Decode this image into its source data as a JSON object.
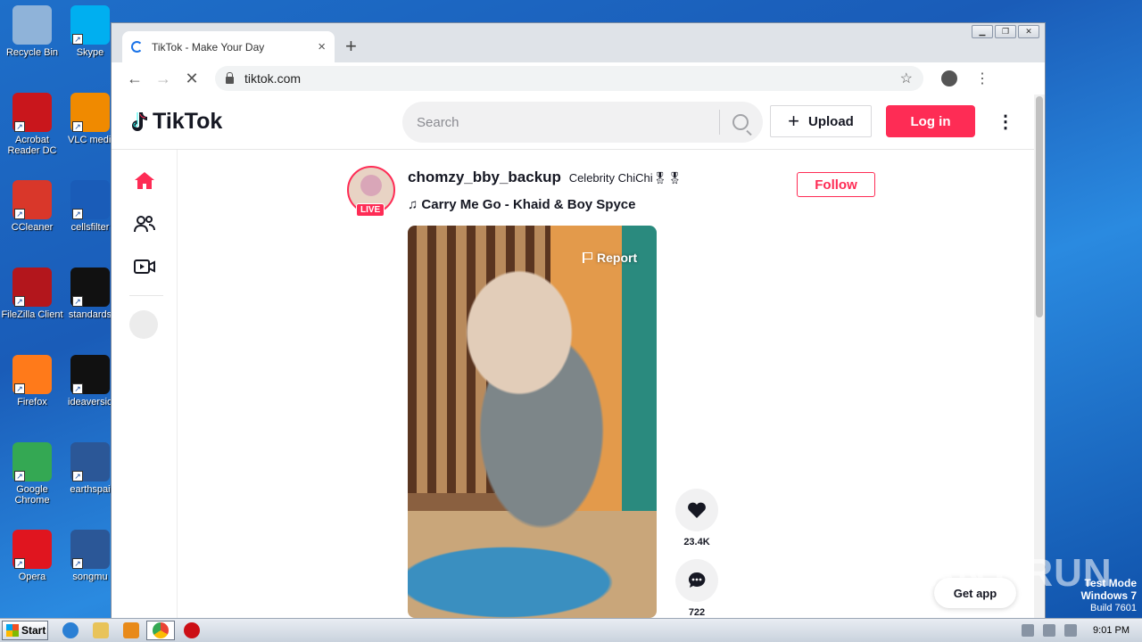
{
  "desktop": {
    "icons": [
      {
        "label": "Recycle Bin",
        "color": "#8fb3d9"
      },
      {
        "label": "Acrobat Reader DC",
        "color": "#c9161c"
      },
      {
        "label": "CCleaner",
        "color": "#d9372a"
      },
      {
        "label": "FileZilla Client",
        "color": "#b3161c"
      },
      {
        "label": "Firefox",
        "color": "#ff7a1a"
      },
      {
        "label": "Google Chrome",
        "color": "#34a853"
      },
      {
        "label": "Opera",
        "color": "#e0151f"
      }
    ],
    "icons_col2": [
      {
        "label": "Skype",
        "color": "#00aff0"
      },
      {
        "label": "VLC media player",
        "color": "#f08a00"
      },
      {
        "label": "cellsfilter",
        "color": "#1a5cb8"
      },
      {
        "label": "standards",
        "color": "#111111"
      },
      {
        "label": "ideaversio",
        "color": "#111111"
      },
      {
        "label": "earthspai",
        "color": "#2b5797"
      },
      {
        "label": "songmu",
        "color": "#2b5797"
      }
    ]
  },
  "browser": {
    "tab_title": "TikTok - Make Your Day",
    "tab_close": "×",
    "new_tab": "+",
    "url": "tiktok.com",
    "back": "←",
    "forward": "→",
    "stop": "✕",
    "star": "☆",
    "menu": "⋮"
  },
  "tiktok": {
    "logo": "TikTok",
    "search_placeholder": "Search",
    "upload_label": "Upload",
    "login_label": "Log in",
    "more": "⋮",
    "post": {
      "username": "chomzy_bby_backup",
      "nickname": "Celebrity ChiChi🎖🎖",
      "live_badge": "LIVE",
      "music": "Carry Me Go - Khaid & Boy Spyce",
      "follow_label": "Follow",
      "report_label": "Report",
      "likes": "23.4K",
      "comments": "722"
    },
    "get_app": "Get app"
  },
  "watermark": "ANY RUN",
  "testmode": {
    "line1": "Test Mode",
    "line2": "Windows 7",
    "line3": "Build 7601"
  },
  "taskbar": {
    "start": "Start",
    "clock": "9:01 PM"
  }
}
